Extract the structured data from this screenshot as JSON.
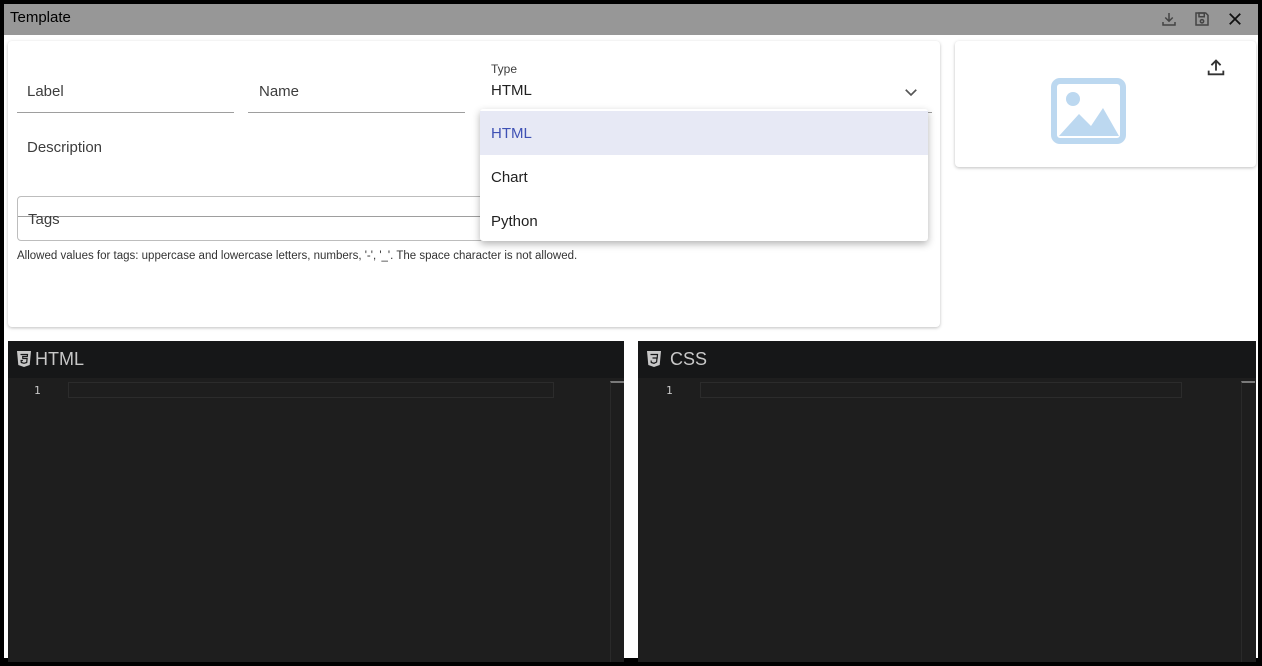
{
  "window": {
    "title": "Template",
    "actions": [
      {
        "name": "download",
        "icon": "download-icon"
      },
      {
        "name": "save",
        "icon": "save-icon"
      },
      {
        "name": "close",
        "icon": "close-icon"
      }
    ]
  },
  "form": {
    "label_field": {
      "label": "Label",
      "value": ""
    },
    "name_field": {
      "label": "Name",
      "value": ""
    },
    "type_field": {
      "label": "Type",
      "value": "HTML"
    },
    "description_field": {
      "label": "Description",
      "value": ""
    },
    "tags_field": {
      "label": "Tags",
      "value": ""
    },
    "tags_helper": "Allowed values for tags: uppercase and lowercase letters, numbers, '-', '_'. The space character is not allowed."
  },
  "type_dropdown": {
    "options": [
      "HTML",
      "Chart",
      "Python"
    ],
    "selected": "HTML"
  },
  "image_panel": {
    "upload_icon": "upload-icon",
    "placeholder_icon": "image-placeholder-icon"
  },
  "editors": [
    {
      "name": "HTML",
      "icon": "html5-icon",
      "line_numbers": [
        "1"
      ]
    },
    {
      "name": "CSS",
      "icon": "css3-icon",
      "line_numbers": [
        "1"
      ]
    }
  ],
  "colors": {
    "titlebar": "#979797",
    "accent": "#3f51b5",
    "selected_option_bg": "#e7e9f5",
    "editor_bg": "#1e1e1e",
    "image_icon": "#bcd8f0"
  }
}
